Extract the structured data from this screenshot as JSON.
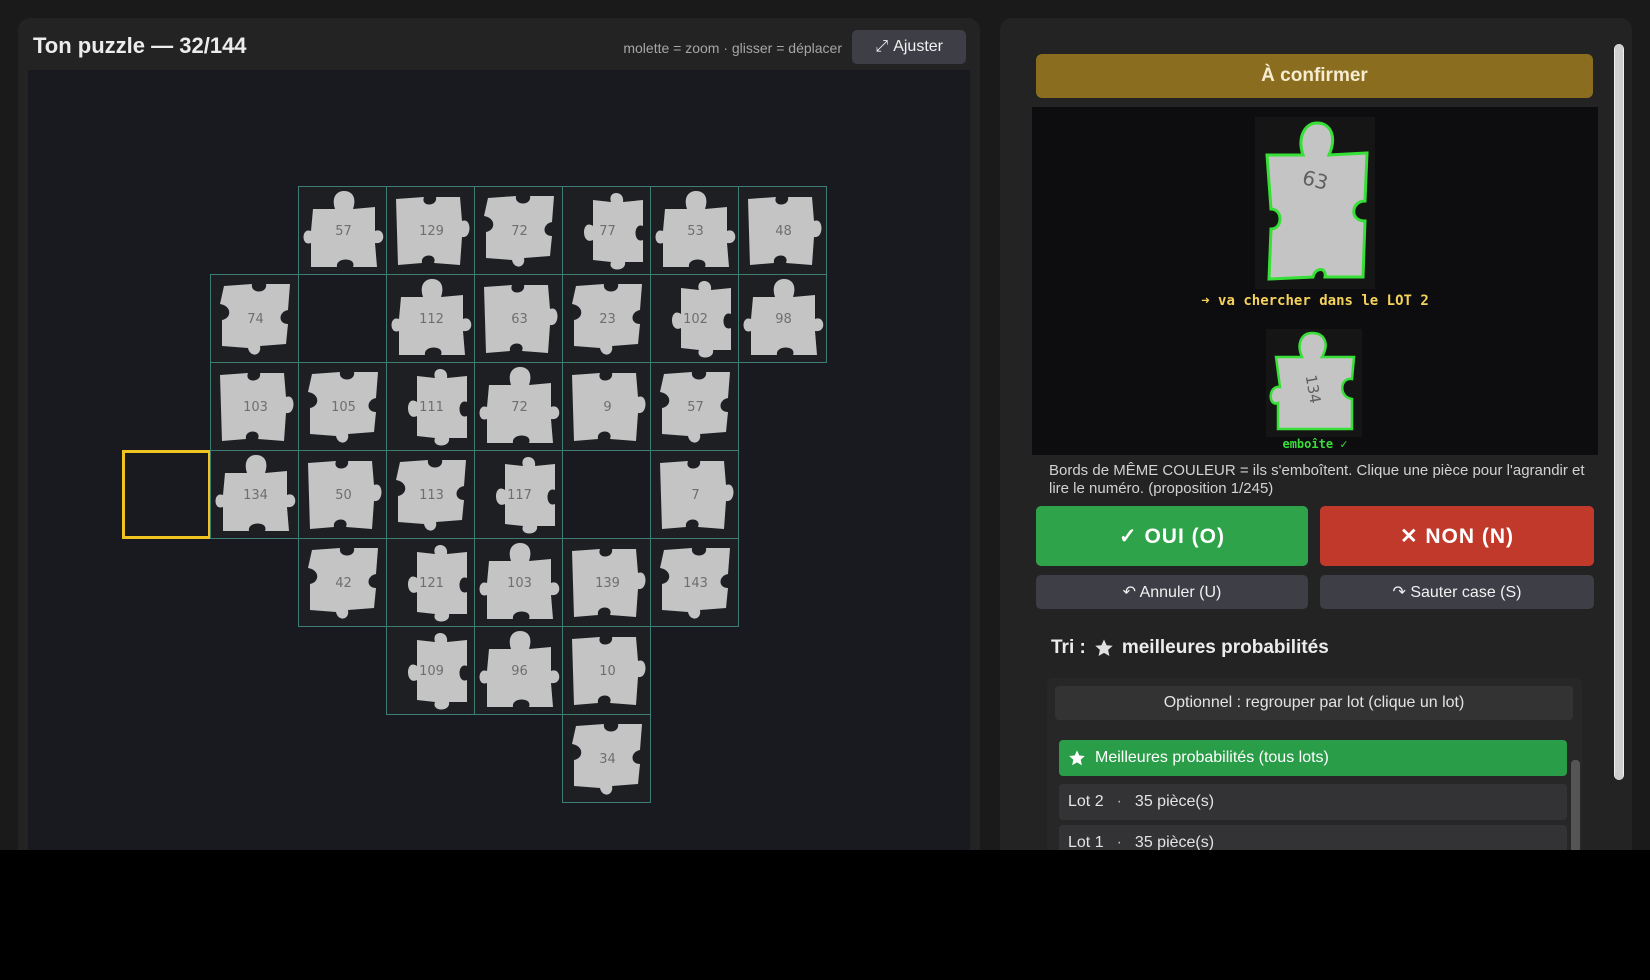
{
  "left": {
    "title": "Ton puzzle — 32/144",
    "hint": "molette = zoom · glisser = déplacer",
    "fit_button": "Ajuster",
    "fit_icon": "expand-arrows-icon"
  },
  "grid": {
    "piece_color": "#c4c4c4",
    "cell_border_color": "#3e7d73",
    "target_color": "#f0c420",
    "cells": [
      {
        "row": 0,
        "col": 2,
        "label": "57"
      },
      {
        "row": 0,
        "col": 3,
        "label": "129"
      },
      {
        "row": 0,
        "col": 4,
        "label": "72"
      },
      {
        "row": 0,
        "col": 5,
        "label": "77"
      },
      {
        "row": 0,
        "col": 6,
        "label": "53"
      },
      {
        "row": 0,
        "col": 7,
        "label": "48"
      },
      {
        "row": 1,
        "col": 1,
        "label": "74"
      },
      {
        "row": 1,
        "col": 2,
        "label": ""
      },
      {
        "row": 1,
        "col": 3,
        "label": "112"
      },
      {
        "row": 1,
        "col": 4,
        "label": "63"
      },
      {
        "row": 1,
        "col": 5,
        "label": "23"
      },
      {
        "row": 1,
        "col": 6,
        "label": "102"
      },
      {
        "row": 1,
        "col": 7,
        "label": "98"
      },
      {
        "row": 2,
        "col": 1,
        "label": "103"
      },
      {
        "row": 2,
        "col": 2,
        "label": "105"
      },
      {
        "row": 2,
        "col": 3,
        "label": "111"
      },
      {
        "row": 2,
        "col": 4,
        "label": "72"
      },
      {
        "row": 2,
        "col": 5,
        "label": "9"
      },
      {
        "row": 2,
        "col": 6,
        "label": "57"
      },
      {
        "row": 3,
        "col": 0,
        "label": "",
        "target": true
      },
      {
        "row": 3,
        "col": 1,
        "label": "134"
      },
      {
        "row": 3,
        "col": 2,
        "label": "50"
      },
      {
        "row": 3,
        "col": 3,
        "label": "113"
      },
      {
        "row": 3,
        "col": 4,
        "label": "117"
      },
      {
        "row": 3,
        "col": 5,
        "label": ""
      },
      {
        "row": 3,
        "col": 6,
        "label": "7"
      },
      {
        "row": 4,
        "col": 2,
        "label": "42"
      },
      {
        "row": 4,
        "col": 3,
        "label": "121"
      },
      {
        "row": 4,
        "col": 4,
        "label": "103"
      },
      {
        "row": 4,
        "col": 5,
        "label": "139"
      },
      {
        "row": 4,
        "col": 6,
        "label": "143"
      },
      {
        "row": 5,
        "col": 3,
        "label": "109"
      },
      {
        "row": 5,
        "col": 4,
        "label": "96"
      },
      {
        "row": 5,
        "col": 5,
        "label": "10"
      },
      {
        "row": 6,
        "col": 5,
        "label": "34"
      }
    ]
  },
  "right": {
    "confirm_banner": "À confirmer",
    "preview": {
      "piece_top_label": "63",
      "piece_bottom_label": "134",
      "instruction": "➜ va chercher dans le LOT 2",
      "fits": "emboîte ✓",
      "edge_color": "#36e036"
    },
    "explain": "Bords de MÊME COULEUR = ils s'emboîtent.  Clique une pièce pour l'agrandir et lire le numéro.  (proposition 1/245)",
    "yes_button": "✓  OUI  (O)",
    "no_button": "✕  NON  (N)",
    "undo_button": "↶ Annuler (U)",
    "skip_button": "↷ Sauter case (S)",
    "sort_prefix": "Tri :",
    "sort_value": "meilleures probabilités",
    "sort_icon": "star-icon",
    "group_header": "Optionnel : regrouper par lot (clique un lot)",
    "options": [
      {
        "label": "Meilleures probabilités (tous lots)",
        "icon": "star-icon",
        "active": true
      },
      {
        "lot": "Lot 2",
        "count": "35 pièce(s)"
      },
      {
        "lot": "Lot 1",
        "count": "35 pièce(s)"
      }
    ]
  }
}
